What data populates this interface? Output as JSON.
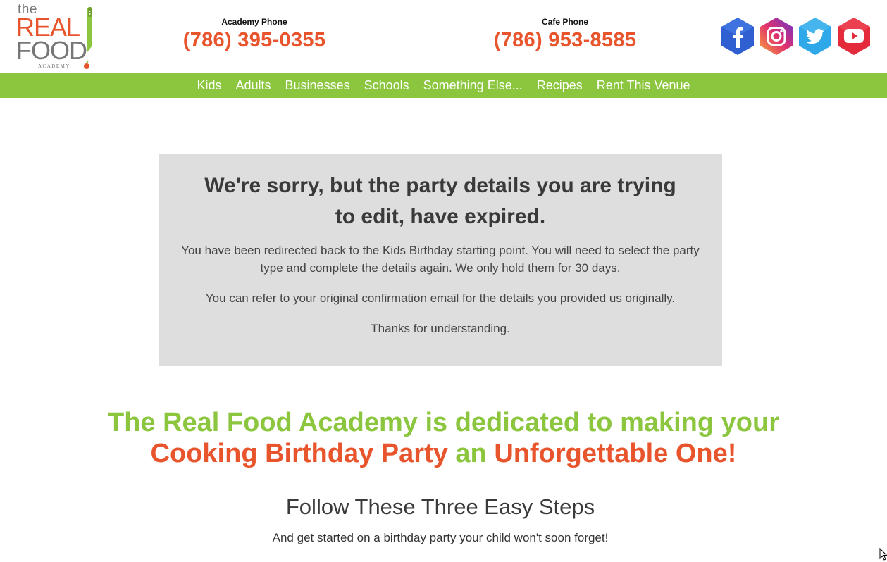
{
  "logo": {
    "the": "the",
    "real": "REAL",
    "food": "FOOD",
    "academy": "ACADEMY"
  },
  "header": {
    "academy_phone_label": "Academy Phone",
    "academy_phone": "(786) 395-0355",
    "cafe_phone_label": "Cafe Phone",
    "cafe_phone": "(786) 953-8585",
    "social": [
      "facebook-icon",
      "instagram-icon",
      "twitter-icon",
      "youtube-icon"
    ]
  },
  "nav": {
    "items": [
      "Kids",
      "Adults",
      "Businesses",
      "Schools",
      "Something Else...",
      "Recipes",
      "Rent This Venue"
    ]
  },
  "notice": {
    "heading": "We're sorry, but the party details you are trying to edit, have expired.",
    "p1": "You have been redirected back to the Kids Birthday starting point. You will need to select the party type and complete the details again. We only hold them for 30 days.",
    "p2": "You can refer to your original confirmation email for the details you provided us originally.",
    "p3": "Thanks for understanding."
  },
  "headline": {
    "line1": "The Real Food Academy is dedicated to making your",
    "part_a": "Cooking Birthday Party",
    "part_b": " an ",
    "part_c": "Unforgettable One!"
  },
  "steps": {
    "title": "Follow These Three Easy Steps",
    "subtitle": "And get started on a birthday party your child won't soon forget!"
  },
  "colors": {
    "brand_green": "#8bc63e",
    "brand_orange": "#e8552d",
    "notice_bg": "#dedede"
  }
}
